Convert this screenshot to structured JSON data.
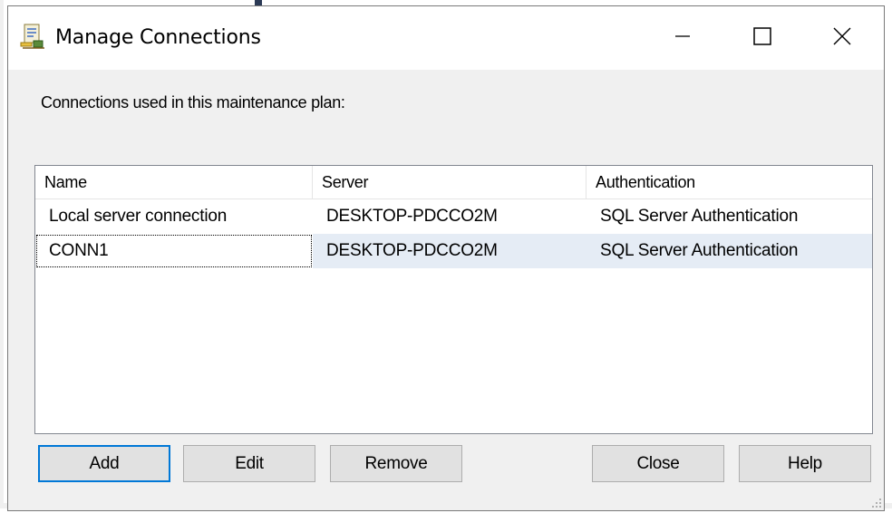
{
  "window": {
    "title": "Manage Connections",
    "icon": "manage-connections-app-icon",
    "controls": [
      "minimize-icon",
      "maximize-icon",
      "close-icon"
    ]
  },
  "dialog": {
    "caption": "Connections used in this maintenance plan:"
  },
  "table": {
    "columns": [
      "Name",
      "Server",
      "Authentication"
    ],
    "rows": [
      [
        "Local server connection",
        "DESKTOP-PDCCO2M",
        "SQL Server Authentication"
      ],
      [
        "CONN1",
        "DESKTOP-PDCCO2M",
        "SQL Server Authentication"
      ]
    ],
    "selected_row": 1
  },
  "buttons": {
    "add": "Add",
    "edit": "Edit",
    "remove": "Remove",
    "close": "Close",
    "help": "Help"
  },
  "colors": {
    "accent": "#0078d7",
    "dialog_bg": "#f0f0f0",
    "selected_row_bg": "#e5ecf5"
  }
}
